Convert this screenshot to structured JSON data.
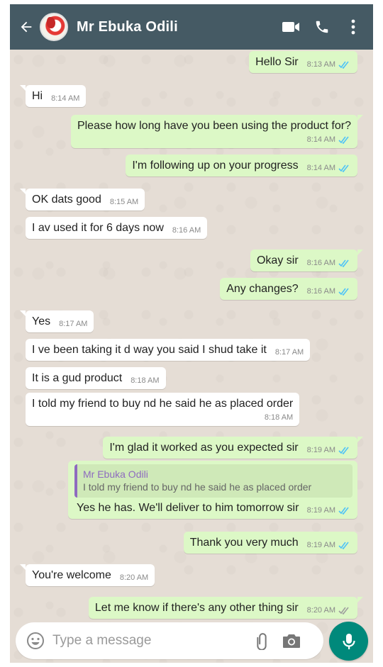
{
  "header": {
    "contact_name": "Mr Ebuka Odili",
    "icons": [
      "back-arrow-icon",
      "video-call-icon",
      "phone-call-icon",
      "more-options-icon"
    ]
  },
  "colors": {
    "header_bg": "#455a64",
    "chat_bg": "#e5ddd5",
    "incoming_bubble": "#ffffff",
    "outgoing_bubble": "#dcf8c6",
    "read_ticks": "#4fc3f7",
    "sent_ticks": "#9e9e9e",
    "mic_button": "#00897b",
    "quote_accent": "#8e6bbf"
  },
  "messages": [
    {
      "dir": "out",
      "text": "Hello Sir",
      "time": "8:13 AM",
      "status": "read"
    },
    {
      "dir": "in",
      "text": "Hi",
      "time": "8:14 AM"
    },
    {
      "dir": "out",
      "text": "Please how long have you been using the product for?",
      "time": "8:14 AM",
      "status": "read"
    },
    {
      "dir": "out",
      "text": "I'm following up on your progress",
      "time": "8:14 AM",
      "status": "read"
    },
    {
      "dir": "in",
      "text": "OK dats good",
      "time": "8:15 AM"
    },
    {
      "dir": "in",
      "text": "I av used it for 6 days now",
      "time": "8:16 AM"
    },
    {
      "dir": "out",
      "text": "Okay sir",
      "time": "8:16 AM",
      "status": "read"
    },
    {
      "dir": "out",
      "text": "Any changes?",
      "time": "8:16 AM",
      "status": "read"
    },
    {
      "dir": "in",
      "text": "Yes",
      "time": "8:17 AM"
    },
    {
      "dir": "in",
      "text": "I ve been taking it d way you said I shud take it",
      "time": "8:17 AM"
    },
    {
      "dir": "in",
      "text": "It is a gud product",
      "time": "8:18 AM"
    },
    {
      "dir": "in",
      "text": "I told my friend to buy nd he said he as placed order",
      "time": "8:18 AM"
    },
    {
      "dir": "out",
      "text": "I'm glad it worked as you expected sir",
      "time": "8:19 AM",
      "status": "read"
    },
    {
      "dir": "out",
      "text": "Yes he has. We'll deliver to him tomorrow sir",
      "time": "8:19 AM",
      "status": "read",
      "quote": {
        "author": "Mr Ebuka Odili",
        "text": "I told my friend to buy nd he said he as placed order"
      }
    },
    {
      "dir": "out",
      "text": "Thank you very much",
      "time": "8:19 AM",
      "status": "read"
    },
    {
      "dir": "in",
      "text": "You're welcome",
      "time": "8:20 AM"
    },
    {
      "dir": "out",
      "text": "Let me know if there's any other thing sir",
      "time": "8:20 AM",
      "status": "delivered"
    }
  ],
  "composer": {
    "placeholder": "Type a message",
    "icons": [
      "emoji-icon",
      "attachment-icon",
      "camera-icon",
      "microphone-icon"
    ]
  }
}
